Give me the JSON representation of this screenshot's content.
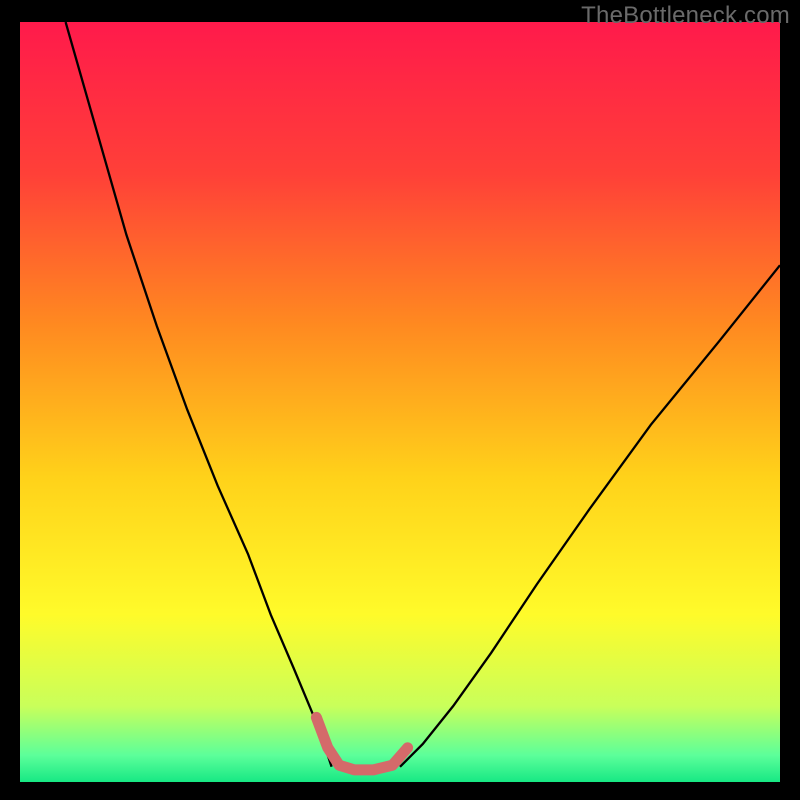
{
  "watermark": "TheBottleneck.com",
  "chart_data": {
    "type": "line",
    "title": "",
    "xlabel": "",
    "ylabel": "",
    "xlim": [
      0,
      100
    ],
    "ylim": [
      0,
      100
    ],
    "gradient_stops": [
      {
        "offset": 0.0,
        "color": "#ff1a4b"
      },
      {
        "offset": 0.2,
        "color": "#ff4038"
      },
      {
        "offset": 0.4,
        "color": "#ff8a20"
      },
      {
        "offset": 0.6,
        "color": "#ffd21a"
      },
      {
        "offset": 0.78,
        "color": "#fffb2a"
      },
      {
        "offset": 0.9,
        "color": "#c9ff5a"
      },
      {
        "offset": 0.965,
        "color": "#5cff9a"
      },
      {
        "offset": 1.0,
        "color": "#17e884"
      }
    ],
    "series": [
      {
        "name": "left-curve",
        "stroke": "#000000",
        "stroke_width": 2.3,
        "x": [
          6,
          10,
          14,
          18,
          22,
          26,
          30,
          33,
          36,
          38.5,
          40,
          41
        ],
        "y": [
          100,
          86,
          72,
          60,
          49,
          39,
          30,
          22,
          15,
          9,
          5,
          2
        ]
      },
      {
        "name": "right-curve",
        "stroke": "#000000",
        "stroke_width": 2.3,
        "x": [
          50,
          53,
          57,
          62,
          68,
          75,
          83,
          92,
          100
        ],
        "y": [
          2,
          5,
          10,
          17,
          26,
          36,
          47,
          58,
          68
        ]
      },
      {
        "name": "valley-highlight",
        "stroke": "#d46a6a",
        "stroke_width": 11,
        "linecap": "round",
        "x": [
          39,
          40.5,
          42,
          44,
          46.5,
          49,
          51
        ],
        "y": [
          8.5,
          4.5,
          2.2,
          1.6,
          1.6,
          2.2,
          4.5
        ]
      }
    ]
  }
}
